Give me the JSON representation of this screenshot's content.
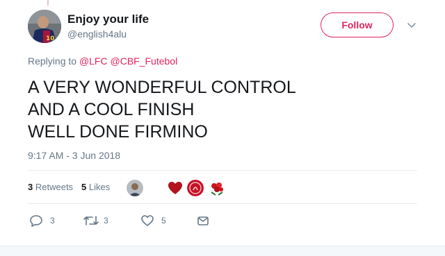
{
  "tweet": {
    "author_name": "Enjoy your life",
    "author_handle": "@english4alu",
    "follow_label": "Follow",
    "replying_prefix": "Replying to",
    "mentions": [
      "@LFC",
      "@CBF_Futebol"
    ],
    "text_lines": [
      "A VERY WONDERFUL CONTROL",
      "AND A COOL FINISH",
      "WELL DONE FIRMINO"
    ],
    "timestamp": "9:17 AM - 3 Jun 2018"
  },
  "stats": {
    "retweets_count": "3",
    "retweets_label": "Retweets",
    "likes_count": "5",
    "likes_label": "Likes"
  },
  "actions": {
    "reply_count": "3",
    "retweet_count": "3",
    "like_count": "5"
  },
  "colors": {
    "accent": "#e0245e",
    "secondary_text": "#657786",
    "primary_text": "#14171a"
  },
  "icons": [
    "chevron-down-icon",
    "reply-icon",
    "retweet-icon",
    "like-icon",
    "message-icon"
  ]
}
